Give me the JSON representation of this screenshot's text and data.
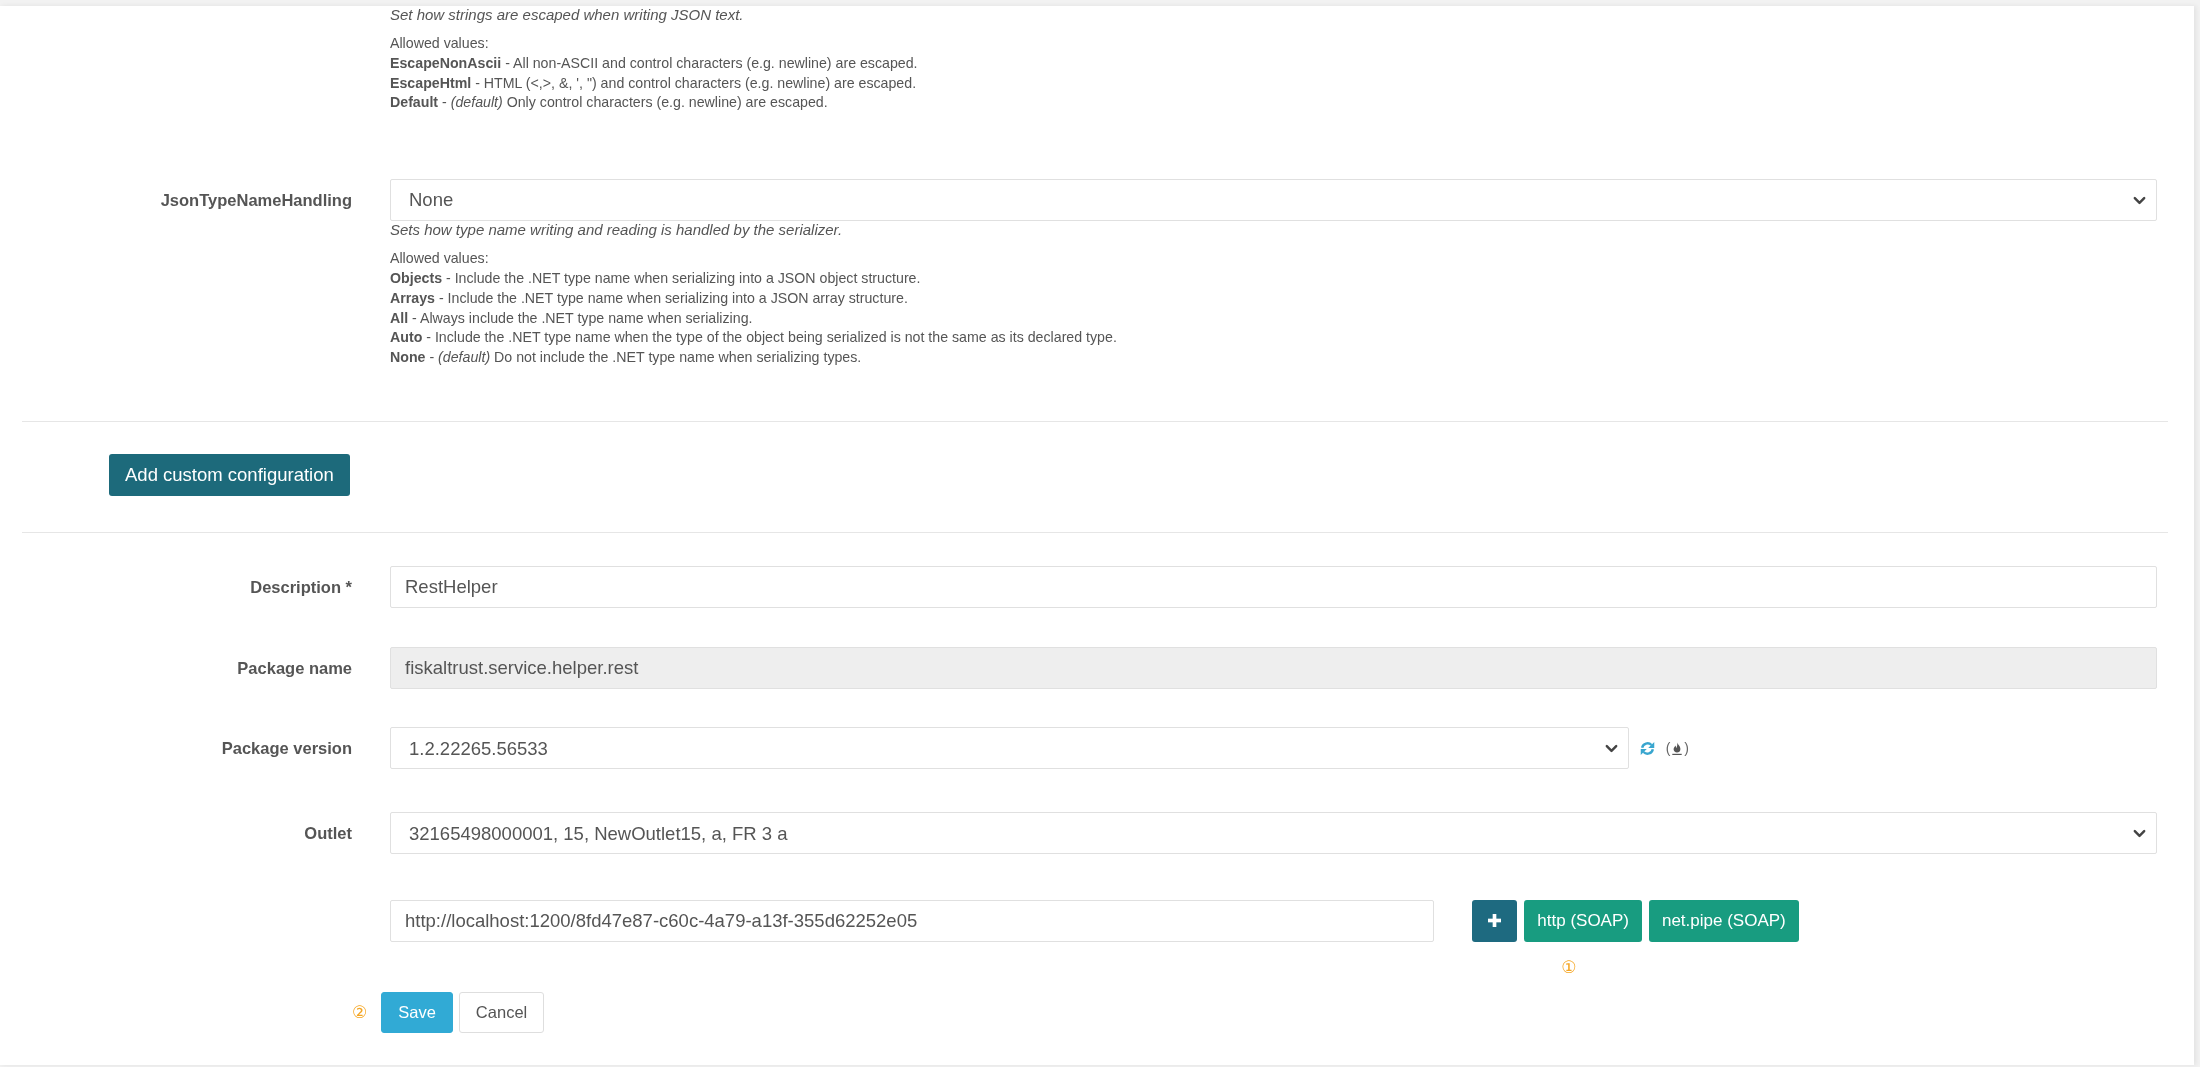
{
  "settings": [
    {
      "description": "Set how strings are escaped when writing JSON text.",
      "allowed_values_label": "Allowed values:",
      "allowed_values": [
        "**EscapeNonAscii** - All non-ASCII and control characters (e.g. newline) are escaped.",
        "**EscapeHtml** - HTML (<,>, &, ', \") and control characters (e.g. newline) are escaped.",
        "**Default** - *(default)* Only control characters (e.g. newline) are escaped."
      ]
    },
    {
      "label": "JsonTypeNameHandling",
      "value": "None",
      "description": "Sets how type name writing and reading is handled by the serializer.",
      "allowed_values_label": "Allowed values:",
      "allowed_values": [
        "**Objects** - Include the .NET type name when serializing into a JSON object structure.",
        "**Arrays** - Include the .NET type name when serializing into a JSON array structure.",
        "**All** - Always include the .NET type name when serializing.",
        "**Auto** - Include the .NET type name when the type of the object being serialized is not the same as its declared type.",
        "**None** - *(default)* Do not include the .NET type name when serializing types."
      ]
    }
  ],
  "add_custom_configuration_button": "Add custom configuration",
  "fields": [
    {
      "kind": "text",
      "label": "Description *",
      "value": "RestHelper"
    },
    {
      "kind": "readonly",
      "label": "Package name",
      "value": "fiskaltrust.service.helper.rest"
    },
    {
      "kind": "select",
      "label": "Package version",
      "value": "1.2.22265.56533",
      "refresh": true,
      "prerelease_brackets": [
        "(",
        ")"
      ]
    },
    {
      "kind": "select",
      "label": "Outlet",
      "value": "32165498000001, 15, NewOutlet15, a, FR 3 a"
    }
  ],
  "endpoint": {
    "url": "http://localhost:1200/8fd47e87-c60c-4a79-a13f-355d62252e05",
    "buttons": [
      {
        "kind": "add"
      },
      {
        "kind": "protocol",
        "label": "http (SOAP)"
      },
      {
        "kind": "protocol",
        "label": "net.pipe (SOAP)"
      }
    ],
    "hint_marker": "①"
  },
  "actions": {
    "hint_marker": "②",
    "buttons": [
      {
        "kind": "primary",
        "label": "Save"
      },
      {
        "kind": "secondary",
        "label": "Cancel"
      }
    ]
  }
}
